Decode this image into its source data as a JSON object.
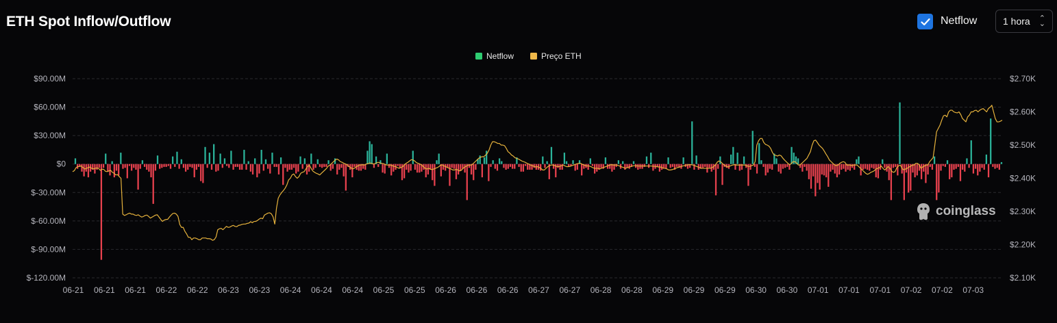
{
  "header": {
    "title": "ETH Spot Inflow/Outflow",
    "netflow_toggle_label": "Netflow",
    "netflow_checked": true,
    "interval_value": "1 hora"
  },
  "watermark": {
    "text": "coinglass"
  },
  "colors": {
    "inflow": "#2bb39a",
    "outflow": "#e8414e",
    "price": "#e6b23c",
    "legend_netflow": "#2ecc71",
    "legend_price": "#f0b94a",
    "grid": "#2a2a2e",
    "axis_text": "#b5b5bd"
  },
  "chart_data": {
    "type": "bar",
    "legend": [
      {
        "name": "Netflow"
      },
      {
        "name": "Preço ETH"
      }
    ],
    "x_tick_labels": [
      "06-21",
      "06-21",
      "06-21",
      "06-22",
      "06-22",
      "06-23",
      "06-23",
      "06-24",
      "06-24",
      "06-24",
      "06-25",
      "06-25",
      "06-26",
      "06-26",
      "06-26",
      "06-27",
      "06-27",
      "06-28",
      "06-28",
      "06-29",
      "06-29",
      "06-29",
      "06-30",
      "06-30",
      "07-01",
      "07-01",
      "07-01",
      "07-02",
      "07-02",
      "07-03"
    ],
    "y_left_label_values": [
      "$90.00M",
      "$60.00M",
      "$30.00M",
      "$0",
      "$-30.00M",
      "$-60.00M",
      "$-90.00M",
      "$-120.00M"
    ],
    "y_right_label_values": [
      "$2.70K",
      "$2.60K",
      "$2.50K",
      "$2.40K",
      "$2.30K",
      "$2.20K",
      "$2.10K"
    ],
    "ylim_left": [
      -120,
      90
    ],
    "ylim_right": [
      2.1,
      2.7
    ],
    "grid": true,
    "legend_position": "top-center",
    "series": [
      {
        "name": "Netflow",
        "type": "bar",
        "unit": "$M",
        "values": [
          6,
          -5,
          -3,
          -8,
          -13,
          -8,
          -14,
          -8,
          -6,
          -10,
          -6,
          -4,
          -101,
          -4,
          11,
          -8,
          -12,
          3,
          -14,
          -7,
          -12,
          12,
          -5,
          -4,
          -15,
          -2,
          -7,
          -4,
          -6,
          -27,
          -5,
          4,
          -3,
          -6,
          -8,
          -14,
          -42,
          -7,
          9,
          -5,
          -4,
          -3,
          -3,
          -2,
          -5,
          8,
          -3,
          13,
          -5,
          5,
          -4,
          -8,
          -6,
          -3,
          -4,
          -14,
          -6,
          -3,
          -18,
          -20,
          18,
          -4,
          12,
          -6,
          21,
          -8,
          -7,
          11,
          -4,
          6,
          -2,
          -4,
          14,
          -6,
          -3,
          -3,
          -6,
          -6,
          15,
          -6,
          3,
          -8,
          -11,
          6,
          -14,
          -10,
          15,
          -7,
          5,
          -5,
          -10,
          12,
          -3,
          -3,
          -11,
          7,
          -22,
          -4,
          -8,
          -6,
          -6,
          -4,
          -10,
          -8,
          8,
          -5,
          6,
          -11,
          -8,
          11,
          -6,
          -4,
          5,
          -3,
          -4,
          -3,
          -3,
          4,
          -7,
          -5,
          6,
          -11,
          -6,
          -4,
          -13,
          -28,
          -3,
          -6,
          -14,
          -3,
          -6,
          -7,
          -7,
          -5,
          -6,
          14,
          24,
          21,
          -4,
          8,
          -3,
          4,
          -9,
          -10,
          11,
          -4,
          -12,
          -8,
          -6,
          -2,
          -4,
          -17,
          -15,
          -6,
          -9,
          -7,
          14,
          -6,
          -9,
          -9,
          -8,
          -6,
          -14,
          -11,
          -6,
          -17,
          -23,
          4,
          11,
          -13,
          -6,
          -7,
          -4,
          -23,
          -4,
          -5,
          -16,
          -11,
          -7,
          -5,
          -9,
          -38,
          -4,
          -11,
          -17,
          -6,
          5,
          9,
          -14,
          7,
          14,
          -18,
          -3,
          4,
          -5,
          -7,
          6,
          3,
          -4,
          -6,
          -5,
          -3,
          -5,
          -5,
          7,
          -3,
          -8,
          -8,
          -2,
          -6,
          -6,
          -6,
          -4,
          -6,
          -6,
          -7,
          8,
          -4,
          3,
          -16,
          18,
          -5,
          -14,
          -4,
          -6,
          -6,
          12,
          3,
          -3,
          -2,
          4,
          -7,
          -6,
          4,
          -12,
          -5,
          -4,
          -6,
          6,
          -2,
          -10,
          -8,
          -6,
          -4,
          -5,
          7,
          -5,
          -5,
          -8,
          -6,
          -3,
          4,
          -5,
          3,
          -6,
          -4,
          -5,
          -3,
          3,
          -4,
          -6,
          -5,
          -5,
          -3,
          8,
          -4,
          12,
          -7,
          -5,
          -3,
          -8,
          -6,
          -4,
          -5,
          7,
          -4,
          -3,
          -6,
          -3,
          -4,
          -5,
          7,
          -3,
          -5,
          -4,
          45,
          -6,
          9,
          -6,
          -5,
          -4,
          -3,
          -9,
          -4,
          -8,
          -6,
          -33,
          -5,
          8,
          -22,
          -3,
          -4,
          -5,
          10,
          18,
          -6,
          12,
          -7,
          -6,
          8,
          -4,
          -23,
          -6,
          35,
          -3,
          -10,
          22,
          4,
          -3,
          -12,
          -9,
          -5,
          -6,
          11,
          6,
          -8,
          -10,
          -5,
          -4,
          -3,
          -6,
          18,
          12,
          8,
          6,
          -4,
          -8,
          -3,
          -7,
          -16,
          -26,
          -13,
          -34,
          -20,
          -27,
          -11,
          -12,
          -14,
          -24,
          -8,
          -6,
          -10,
          -14,
          -11,
          -6,
          -5,
          -8,
          -6,
          -7,
          -4,
          -6,
          5,
          8,
          -12,
          -6,
          -5,
          -6,
          -7,
          -4,
          -5,
          -14,
          -15,
          -6,
          5,
          -4,
          -8,
          -17,
          -38,
          -4,
          -3,
          -12,
          65,
          -10,
          -38,
          -9,
          -30,
          -28,
          -9,
          -14,
          -12,
          -7,
          -16,
          -8,
          -20,
          -11,
          -3,
          -6,
          8,
          -38,
          -30,
          -7,
          -2,
          -3,
          4,
          -16,
          -14,
          -6,
          -5,
          -3,
          -18,
          -6,
          -8,
          6,
          -4,
          25,
          -10,
          -5,
          -12,
          -8,
          -4,
          -6,
          10,
          -14,
          48,
          -3,
          -5,
          -4,
          -6,
          2
        ]
      },
      {
        "name": "Preço ETH",
        "type": "line",
        "unit": "$K",
        "values": [
          2.42,
          2.423,
          2.432,
          2.435,
          2.436,
          2.437,
          2.432,
          2.428,
          2.43,
          2.432,
          2.434,
          2.43,
          2.428,
          2.43,
          2.431,
          2.43,
          2.424,
          2.427,
          2.427,
          2.421,
          2.42,
          2.422,
          2.424,
          2.418,
          2.415,
          2.41,
          2.411,
          2.405,
          2.4,
          2.292,
          2.288,
          2.29,
          2.293,
          2.295,
          2.292,
          2.292,
          2.289,
          2.288,
          2.29,
          2.286,
          2.283,
          2.285,
          2.288,
          2.289,
          2.285,
          2.28,
          2.283,
          2.286,
          2.289,
          2.29,
          2.283,
          2.276,
          2.27,
          2.274,
          2.276,
          2.276,
          2.283,
          2.289,
          2.294,
          2.295,
          2.292,
          2.285,
          2.261,
          2.252,
          2.252,
          2.24,
          2.232,
          2.222,
          2.222,
          2.215,
          2.22,
          2.22,
          2.218,
          2.215,
          2.215,
          2.22,
          2.22,
          2.22,
          2.218,
          2.218,
          2.217,
          2.213,
          2.215,
          2.223,
          2.245,
          2.248,
          2.249,
          2.245,
          2.25,
          2.255,
          2.252,
          2.253,
          2.256,
          2.258,
          2.255,
          2.254,
          2.258,
          2.259,
          2.261,
          2.262,
          2.262,
          2.264,
          2.265,
          2.269,
          2.266,
          2.27,
          2.27,
          2.273,
          2.277,
          2.28,
          2.278,
          2.289,
          2.292,
          2.295,
          2.296,
          2.293,
          2.284,
          2.262,
          2.31,
          2.34,
          2.35,
          2.357,
          2.363,
          2.37,
          2.38,
          2.395,
          2.4,
          2.41,
          2.413,
          2.405,
          2.4,
          2.405,
          2.415,
          2.418,
          2.42,
          2.428,
          2.435,
          2.44,
          2.43,
          2.422,
          2.418,
          2.415,
          2.413,
          2.41,
          2.415,
          2.42,
          2.425,
          2.43,
          2.437,
          2.44,
          2.445,
          2.45,
          2.455,
          2.458,
          2.455,
          2.45,
          2.448,
          2.445,
          2.443,
          2.44,
          2.435,
          2.432,
          2.428,
          2.43,
          2.434,
          2.437,
          2.44,
          2.44,
          2.441,
          2.44,
          2.443,
          2.444,
          2.446,
          2.445,
          2.443,
          2.444,
          2.447,
          2.448,
          2.446,
          2.445,
          2.444,
          2.441,
          2.44,
          2.44,
          2.44,
          2.438,
          2.436,
          2.435,
          2.432,
          2.43,
          2.432,
          2.435,
          2.44,
          2.445,
          2.448,
          2.452,
          2.456,
          2.455,
          2.452,
          2.447,
          2.445,
          2.443,
          2.44,
          2.435,
          2.43,
          2.428,
          2.43,
          2.428,
          2.426,
          2.428,
          2.43,
          2.432,
          2.435,
          2.44,
          2.44,
          2.437,
          2.435,
          2.432,
          2.43,
          2.428,
          2.425,
          2.425,
          2.427,
          2.425,
          2.422,
          2.424,
          2.43,
          2.434,
          2.437,
          2.44,
          2.44,
          2.44,
          2.445,
          2.45,
          2.455,
          2.46,
          2.463,
          2.465,
          2.465,
          2.47,
          2.475,
          2.485,
          2.5,
          2.51,
          2.51,
          2.508,
          2.505,
          2.505,
          2.5,
          2.5,
          2.498,
          2.49,
          2.48,
          2.476,
          2.47,
          2.467,
          2.462,
          2.46,
          2.458,
          2.455,
          2.452,
          2.45,
          2.448,
          2.445,
          2.443,
          2.44,
          2.438,
          2.436,
          2.434,
          2.435,
          2.433,
          2.43,
          2.425,
          2.425,
          2.43,
          2.435,
          2.438,
          2.44,
          2.44,
          2.438,
          2.436,
          2.435,
          2.436,
          2.438,
          2.44,
          2.437,
          2.435,
          2.435,
          2.436,
          2.438,
          2.44,
          2.442,
          2.444,
          2.445,
          2.445,
          2.442,
          2.44,
          2.438,
          2.437,
          2.437,
          2.435,
          2.432,
          2.43,
          2.43,
          2.43,
          2.428,
          2.43,
          2.432,
          2.434,
          2.436,
          2.438,
          2.44,
          2.441,
          2.44,
          2.44,
          2.44,
          2.438,
          2.436,
          2.434,
          2.432,
          2.43,
          2.432,
          2.434,
          2.435,
          2.437,
          2.438,
          2.438,
          2.437,
          2.437,
          2.437,
          2.437,
          2.437,
          2.437,
          2.437,
          2.437,
          2.437,
          2.436,
          2.436,
          2.435,
          2.434,
          2.434,
          2.433,
          2.43,
          2.43,
          2.428,
          2.425,
          2.425,
          2.426,
          2.428,
          2.43,
          2.432,
          2.434,
          2.435,
          2.437,
          2.438,
          2.44,
          2.44,
          2.441,
          2.441,
          2.44,
          2.438,
          2.436,
          2.434,
          2.432,
          2.43,
          2.43,
          2.43,
          2.43,
          2.43,
          2.43,
          2.432,
          2.435,
          2.44,
          2.448,
          2.452,
          2.45,
          2.445,
          2.44,
          2.437,
          2.434,
          2.436,
          2.438,
          2.44,
          2.441,
          2.44,
          2.44,
          2.44,
          2.44,
          2.44,
          2.44,
          2.438,
          2.436,
          2.436,
          2.438,
          2.44,
          2.45,
          2.5,
          2.513,
          2.52,
          2.52,
          2.508,
          2.502,
          2.5,
          2.497,
          2.49,
          2.478,
          2.47,
          2.469,
          2.467,
          2.47,
          2.468,
          2.461,
          2.455,
          2.45,
          2.445,
          2.44,
          2.445,
          2.45,
          2.45,
          2.446,
          2.44,
          2.44,
          2.445,
          2.45,
          2.455,
          2.46,
          2.47,
          2.48,
          2.5,
          2.513,
          2.515,
          2.508,
          2.5,
          2.495,
          2.49,
          2.482,
          2.473,
          2.465,
          2.455,
          2.45,
          2.445,
          2.44,
          2.438,
          2.44,
          2.445,
          2.448,
          2.45,
          2.448,
          2.44,
          2.44,
          2.44,
          2.438,
          2.44,
          2.44,
          2.44,
          2.435,
          2.43,
          2.425,
          2.42,
          2.415,
          2.412,
          2.414,
          2.418,
          2.42,
          2.423,
          2.428,
          2.43,
          2.432,
          2.437,
          2.43,
          2.425,
          2.43,
          2.435,
          2.43,
          2.421,
          2.418,
          2.42,
          2.432,
          2.437,
          2.44,
          2.43,
          2.425,
          2.428,
          2.43,
          2.434,
          2.436,
          2.44,
          2.44,
          2.445,
          2.445,
          2.44,
          2.43,
          2.434,
          2.437,
          2.44,
          2.44,
          2.45,
          2.456,
          2.462,
          2.5,
          2.54,
          2.55,
          2.56,
          2.575,
          2.588,
          2.59,
          2.585,
          2.6,
          2.605,
          2.605,
          2.6,
          2.598,
          2.597,
          2.6,
          2.592,
          2.58,
          2.575,
          2.57,
          2.585,
          2.59,
          2.6,
          2.6,
          2.604,
          2.605,
          2.6,
          2.605,
          2.608,
          2.61,
          2.605,
          2.6,
          2.61,
          2.614,
          2.62,
          2.6,
          2.58,
          2.57,
          2.57,
          2.572,
          2.575
        ]
      }
    ]
  }
}
